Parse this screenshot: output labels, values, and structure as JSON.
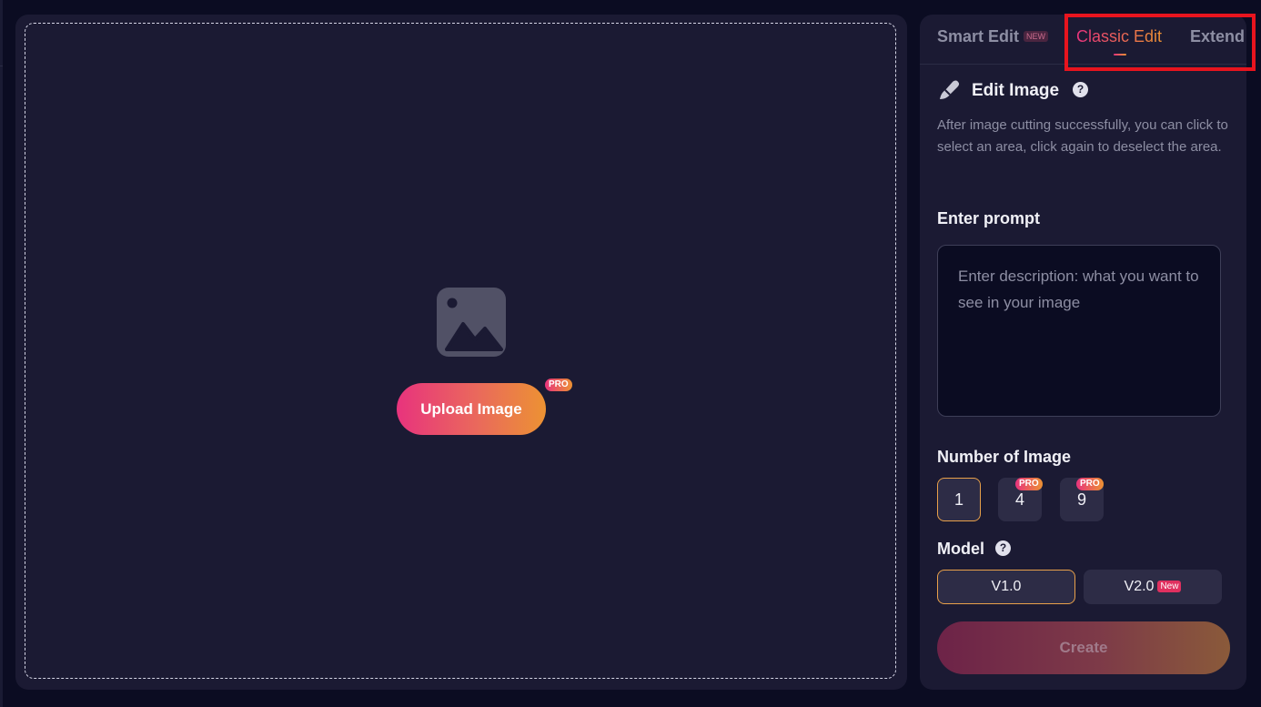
{
  "canvas": {
    "upload_label": "Upload Image",
    "upload_badge": "PRO",
    "placeholder_icon": "image-placeholder-icon"
  },
  "tabs": [
    {
      "label": "Smart Edit",
      "badge": "NEW"
    },
    {
      "label": "Classic Edit",
      "active": true
    },
    {
      "label": "Extend"
    }
  ],
  "edit_image": {
    "title": "Edit Image",
    "help": "?",
    "description": "After image cutting successfully, you can click to select an area, click again to deselect the area."
  },
  "prompt": {
    "label": "Enter prompt",
    "placeholder": "Enter description: what you want to see in your image",
    "value": ""
  },
  "number_of_image": {
    "label": "Number of Image",
    "options": [
      {
        "label": "1",
        "selected": true
      },
      {
        "label": "4",
        "badge": "PRO"
      },
      {
        "label": "9",
        "badge": "PRO"
      }
    ]
  },
  "model": {
    "label": "Model",
    "help": "?",
    "options": [
      {
        "label": "V1.0",
        "selected": true
      },
      {
        "label": "V2.0",
        "badge": "New"
      }
    ]
  },
  "create_label": "Create",
  "colors": {
    "background": "#0b0c22",
    "panel": "#1b1a33",
    "accent_start": "#e8337d",
    "accent_end": "#ec9233",
    "highlight": "#e8141e"
  }
}
